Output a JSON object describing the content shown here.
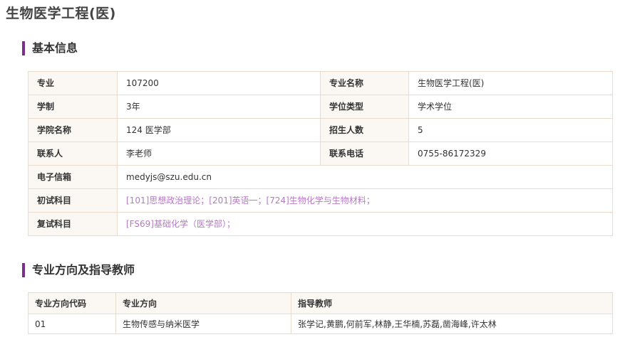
{
  "page": {
    "title": "生物医学工程(医)"
  },
  "basic": {
    "section_title": "基本信息",
    "major_label": "专业",
    "major_value": "107200",
    "major_name_label": "专业名称",
    "major_name_value": "生物医学工程(医)",
    "duration_label": "学制",
    "duration_value": "3年",
    "degree_label": "学位类型",
    "degree_value": "学术学位",
    "college_label": "学院名称",
    "college_value": "124 医学部",
    "enroll_label": "招生人数",
    "enroll_value": "5",
    "contact_label": "联系人",
    "contact_value": "李老师",
    "phone_label": "联系电话",
    "phone_value": "0755-86172329",
    "email_label": "电子信箱",
    "email_value": "medyjs@szu.edu.cn",
    "prelim_label": "初试科目",
    "prelim_value": "[101]思想政治理论；[201]英语一；[724]生物化学与生物材料；",
    "retest_label": "复试科目",
    "retest_value": "[FS69]基础化学（医学部）；"
  },
  "directions": {
    "section_title": "专业方向及指导教师",
    "headers": [
      "专业方向代码",
      "专业方向",
      "指导教师"
    ],
    "rows": [
      [
        "01",
        "生物传感与纳米医学",
        "张学记,黄鹏,何前军,林静,王华楠,苏磊,凿海峰,许太林"
      ]
    ]
  },
  "colors": {
    "accent": "#7a2f8a",
    "link": "#b57ac3",
    "border": "#e9dccd",
    "label_bg": "#fbf8f4"
  }
}
